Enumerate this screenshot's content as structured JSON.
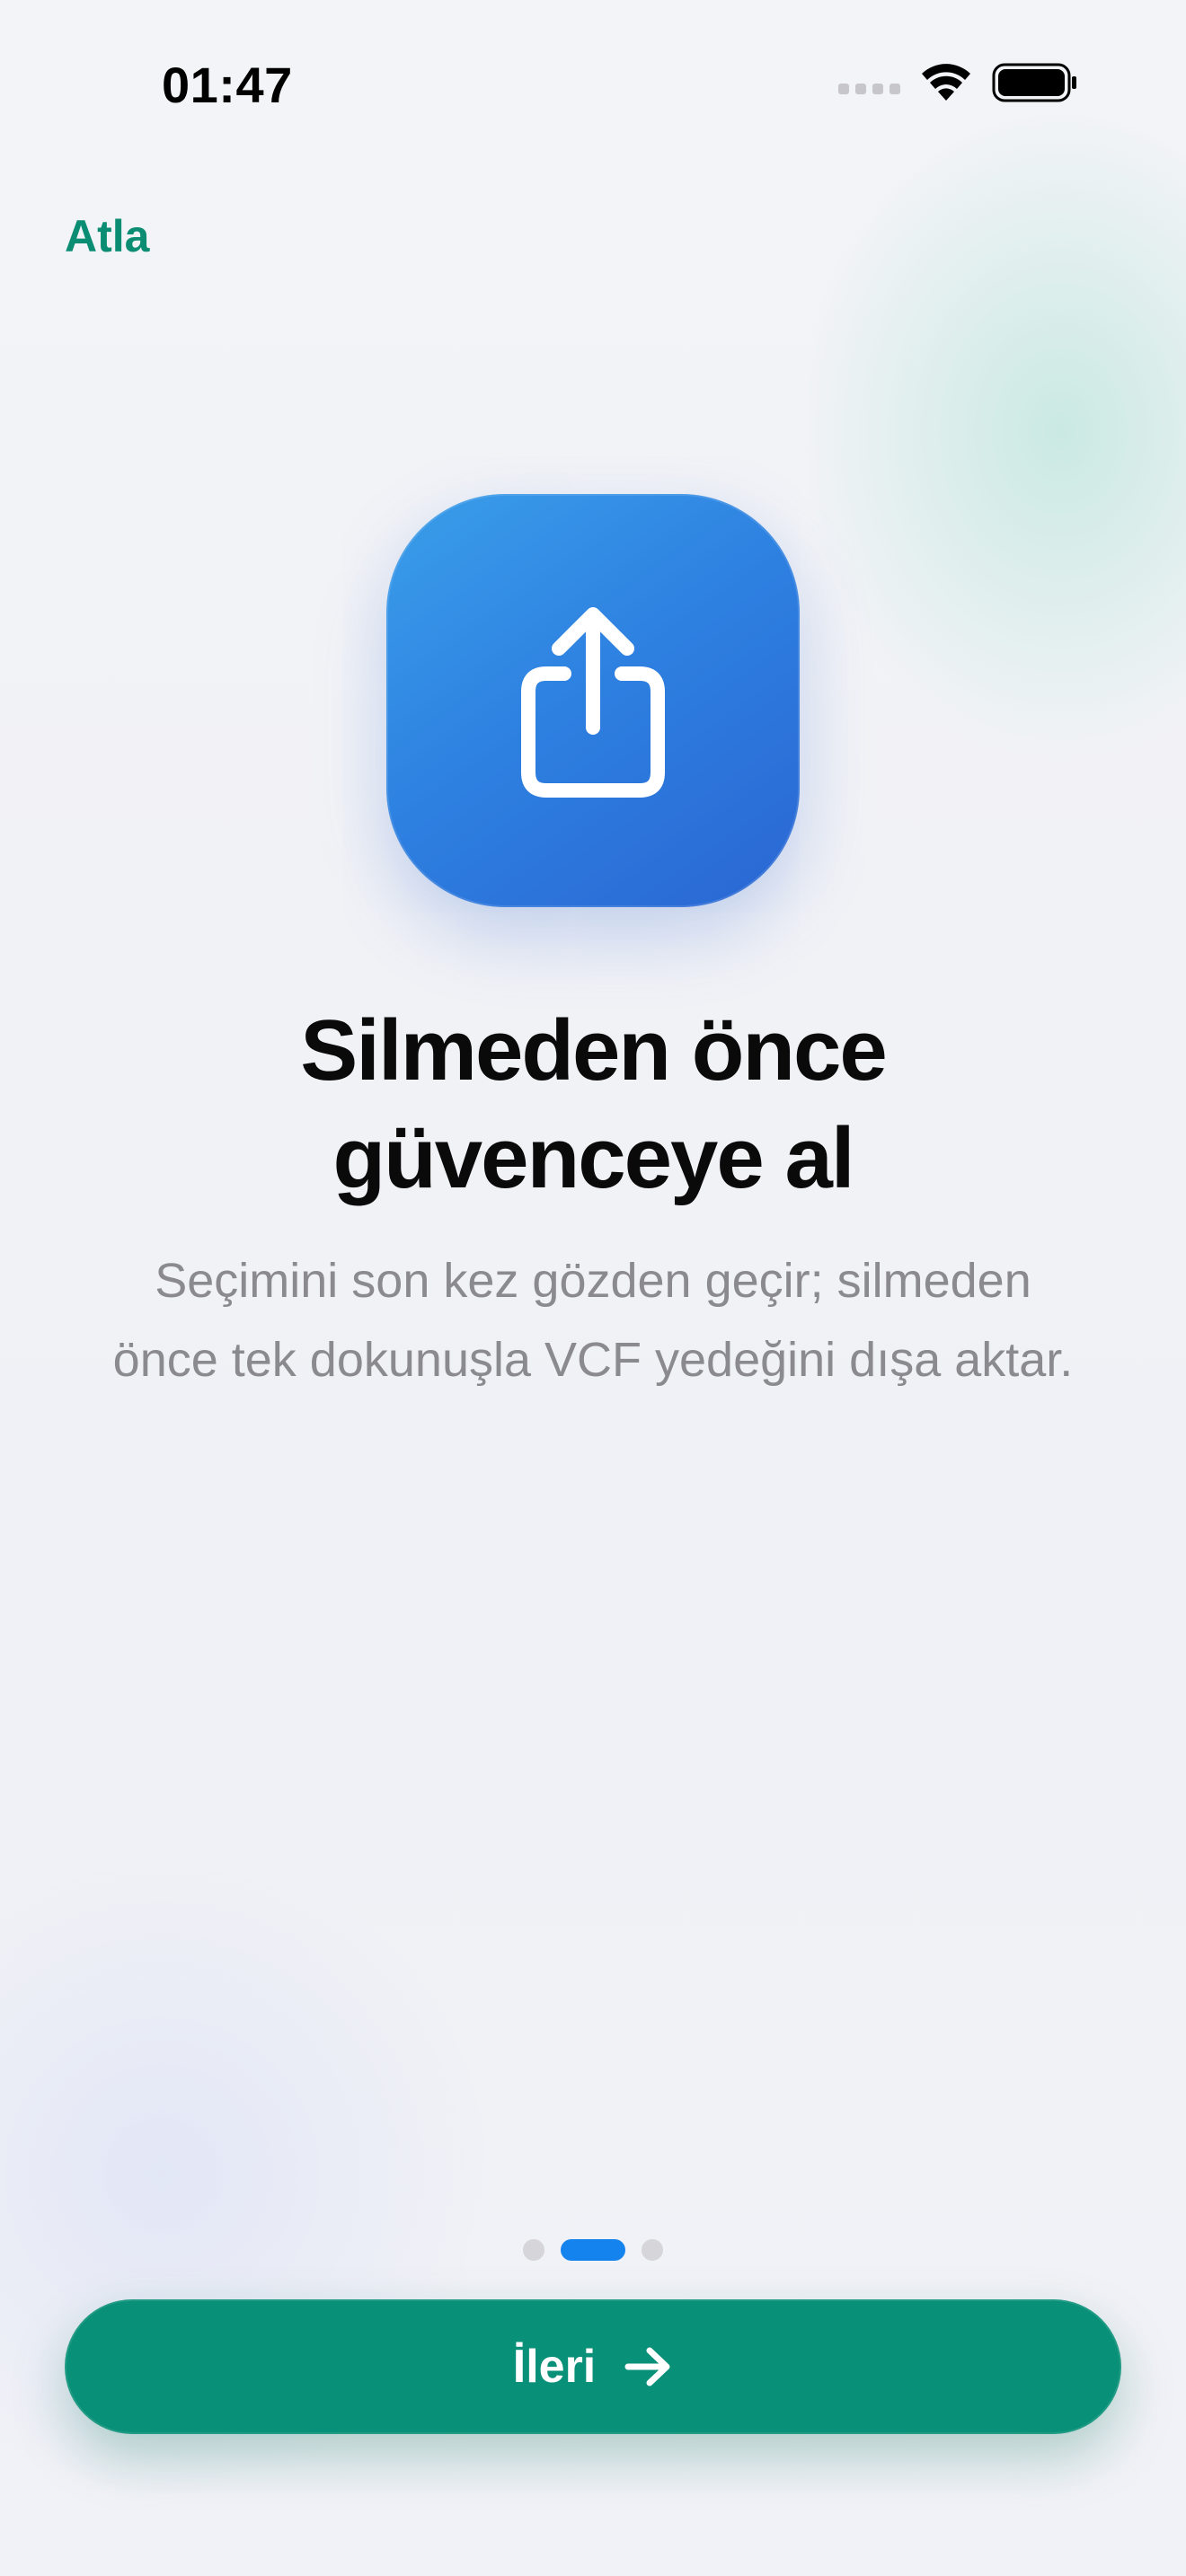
{
  "status_bar": {
    "time": "01:47",
    "icons": [
      "cellular-signal-icon",
      "wifi-icon",
      "battery-icon"
    ]
  },
  "header": {
    "skip_label": "Atla"
  },
  "slide": {
    "icon": "share-export-icon",
    "icon_color": "#2d7fe0",
    "title_line1": "Silmeden önce",
    "title_line2": "güvenceye al",
    "description": "Seçimini son kez gözden geçir; silmeden önce tek dokunuşla VCF yedeğini dışa aktar."
  },
  "pager": {
    "total": 3,
    "active_index": 1,
    "active_color": "#1583ee"
  },
  "footer": {
    "next_label": "İleri",
    "next_icon": "arrow-right-icon",
    "button_color": "#099078"
  },
  "colors": {
    "accent": "#0a8d72"
  }
}
